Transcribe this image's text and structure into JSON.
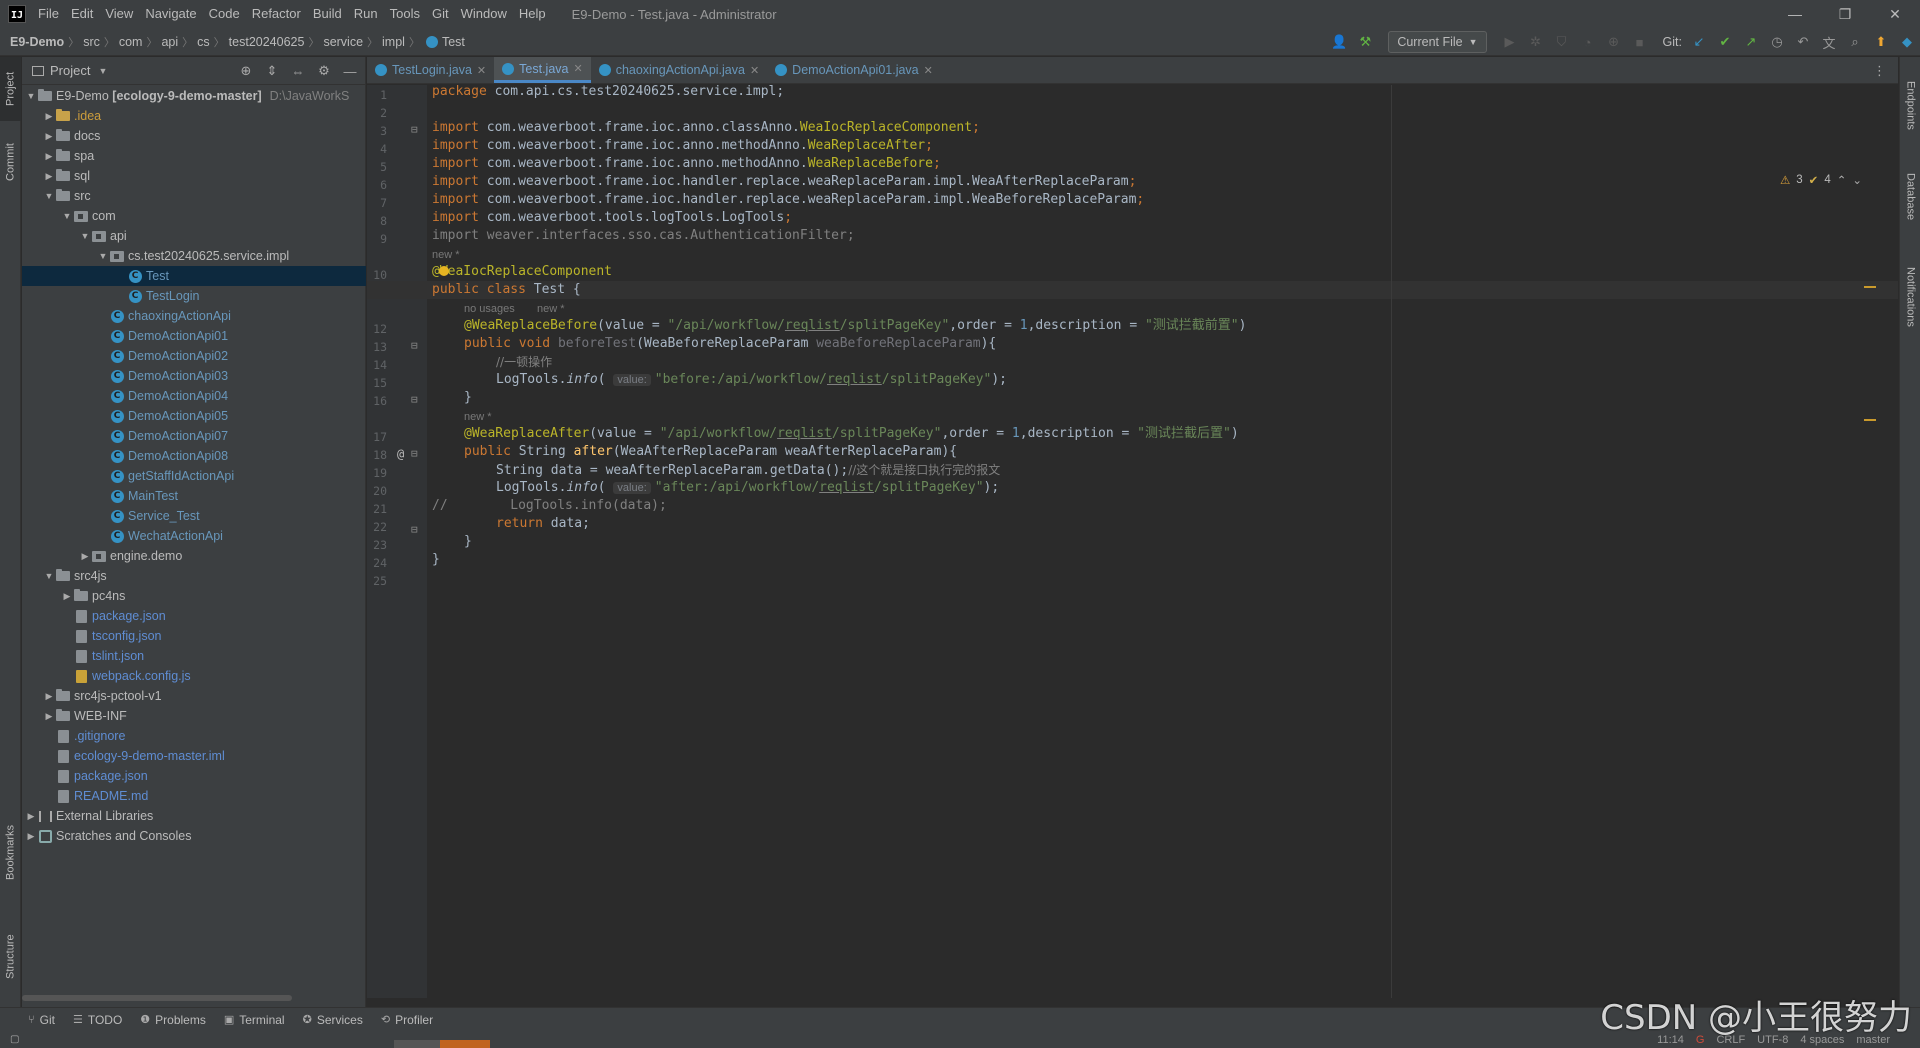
{
  "menubar": {
    "logo_text": "IJ",
    "items": [
      "File",
      "Edit",
      "View",
      "Navigate",
      "Code",
      "Refactor",
      "Build",
      "Run",
      "Tools",
      "Git",
      "Window",
      "Help"
    ],
    "window_title": "E9-Demo - Test.java - Administrator",
    "controls": {
      "minimize": "—",
      "restore": "❐",
      "close": "✕"
    }
  },
  "breadcrumb": {
    "items": [
      "E9-Demo",
      "src",
      "com",
      "api",
      "cs",
      "test20240625",
      "service",
      "impl"
    ],
    "last": "Test"
  },
  "toolbar": {
    "run_config": "Current File",
    "git_label": "Git:",
    "icons": [
      "user-icon",
      "build-hammer-icon",
      "run-icon",
      "debug-icon",
      "coverage-icon",
      "profile-icon",
      "more-run-icon",
      "stop-icon",
      "git-update-icon",
      "git-commit-icon",
      "git-push-icon",
      "history-icon",
      "rollback-icon",
      "translate-icon",
      "search-icon",
      "update-icon",
      "plugin-icon"
    ]
  },
  "left_strip": {
    "project": "Project",
    "commit": "Commit",
    "bookmarks": "Bookmarks",
    "structure": "Structure"
  },
  "right_strip": {
    "endpoints": "Endpoints",
    "database": "Database",
    "notifications": "Notifications"
  },
  "project_panel": {
    "title": "Project",
    "root_name": "E9-Demo",
    "root_module": "[ecology-9-demo-master]",
    "root_path": "D:\\JavaWorkS",
    "tree": [
      {
        "label": ".idea",
        "indent": 1,
        "arrow": "▶",
        "kind": "folder-idea",
        "color": "yellow"
      },
      {
        "label": "docs",
        "indent": 1,
        "arrow": "▶",
        "kind": "folder",
        "color": ""
      },
      {
        "label": "spa",
        "indent": 1,
        "arrow": "▶",
        "kind": "folder",
        "color": ""
      },
      {
        "label": "sql",
        "indent": 1,
        "arrow": "▶",
        "kind": "folder",
        "color": ""
      },
      {
        "label": "src",
        "indent": 1,
        "arrow": "▼",
        "kind": "folder",
        "color": ""
      },
      {
        "label": "com",
        "indent": 2,
        "arrow": "▼",
        "kind": "package",
        "color": ""
      },
      {
        "label": "api",
        "indent": 3,
        "arrow": "▼",
        "kind": "package",
        "color": ""
      },
      {
        "label": "cs.test20240625.service.impl",
        "indent": 4,
        "arrow": "▼",
        "kind": "package",
        "color": ""
      },
      {
        "label": "Test",
        "indent": 5,
        "arrow": "",
        "kind": "class",
        "color": "blue",
        "selected": true
      },
      {
        "label": "TestLogin",
        "indent": 5,
        "arrow": "",
        "kind": "class",
        "color": "blue"
      },
      {
        "label": "chaoxingActionApi",
        "indent": 4,
        "arrow": "",
        "kind": "class",
        "color": "blue"
      },
      {
        "label": "DemoActionApi01",
        "indent": 4,
        "arrow": "",
        "kind": "class",
        "color": "blue"
      },
      {
        "label": "DemoActionApi02",
        "indent": 4,
        "arrow": "",
        "kind": "class",
        "color": "blue"
      },
      {
        "label": "DemoActionApi03",
        "indent": 4,
        "arrow": "",
        "kind": "class",
        "color": "blue"
      },
      {
        "label": "DemoActionApi04",
        "indent": 4,
        "arrow": "",
        "kind": "class",
        "color": "blue"
      },
      {
        "label": "DemoActionApi05",
        "indent": 4,
        "arrow": "",
        "kind": "class",
        "color": "blue"
      },
      {
        "label": "DemoActionApi07",
        "indent": 4,
        "arrow": "",
        "kind": "class",
        "color": "blue"
      },
      {
        "label": "DemoActionApi08",
        "indent": 4,
        "arrow": "",
        "kind": "class",
        "color": "blue"
      },
      {
        "label": "getStaffIdActionApi",
        "indent": 4,
        "arrow": "",
        "kind": "class",
        "color": "blue"
      },
      {
        "label": "MainTest",
        "indent": 4,
        "arrow": "",
        "kind": "class",
        "color": "blue"
      },
      {
        "label": "Service_Test",
        "indent": 4,
        "arrow": "",
        "kind": "class",
        "color": "blue"
      },
      {
        "label": "WechatActionApi",
        "indent": 4,
        "arrow": "",
        "kind": "class",
        "color": "blue"
      },
      {
        "label": "engine.demo",
        "indent": 3,
        "arrow": "▶",
        "kind": "package",
        "color": ""
      },
      {
        "label": "src4js",
        "indent": 1,
        "arrow": "▼",
        "kind": "folder",
        "color": ""
      },
      {
        "label": "pc4ns",
        "indent": 2,
        "arrow": "▶",
        "kind": "folder",
        "color": ""
      },
      {
        "label": "package.json",
        "indent": 2,
        "arrow": "",
        "kind": "file",
        "color": "blue-file"
      },
      {
        "label": "tsconfig.json",
        "indent": 2,
        "arrow": "",
        "kind": "file",
        "color": "blue-file"
      },
      {
        "label": "tslint.json",
        "indent": 2,
        "arrow": "",
        "kind": "file",
        "color": "blue-file"
      },
      {
        "label": "webpack.config.js",
        "indent": 2,
        "arrow": "",
        "kind": "file-js",
        "color": "blue-file"
      },
      {
        "label": "src4js-pctool-v1",
        "indent": 1,
        "arrow": "▶",
        "kind": "folder",
        "color": ""
      },
      {
        "label": "WEB-INF",
        "indent": 1,
        "arrow": "▶",
        "kind": "folder",
        "color": ""
      },
      {
        "label": ".gitignore",
        "indent": 1,
        "arrow": "",
        "kind": "file",
        "color": "blue-file"
      },
      {
        "label": "ecology-9-demo-master.iml",
        "indent": 1,
        "arrow": "",
        "kind": "file",
        "color": "blue-file"
      },
      {
        "label": "package.json",
        "indent": 1,
        "arrow": "",
        "kind": "file",
        "color": "blue-file"
      },
      {
        "label": "README.md",
        "indent": 1,
        "arrow": "",
        "kind": "file",
        "color": "blue-file"
      },
      {
        "label": "External Libraries",
        "indent": 0,
        "arrow": "▶",
        "kind": "lib",
        "color": ""
      },
      {
        "label": "Scratches and Consoles",
        "indent": 0,
        "arrow": "▶",
        "kind": "scratch",
        "color": ""
      }
    ]
  },
  "editor_tabs": [
    {
      "label": "TestLogin.java",
      "active": false
    },
    {
      "label": "Test.java",
      "active": true
    },
    {
      "label": "chaoxingActionApi.java",
      "active": false
    },
    {
      "label": "DemoActionApi01.java",
      "active": false
    }
  ],
  "inspection": {
    "warnings": "3",
    "weak_warnings": "4"
  },
  "code": {
    "line_numbers": [
      "1",
      "2",
      "3",
      "4",
      "5",
      "6",
      "7",
      "8",
      "9",
      "10",
      "11",
      "12",
      "13",
      "14",
      "15",
      "16",
      "17",
      "18",
      "19",
      "20",
      "21",
      "22",
      "23",
      "24",
      "25"
    ],
    "hint_new_class": "new *",
    "hint_usages": "no usages",
    "hint_new_method": "new *",
    "hint_new_method2": "new *",
    "param_hint": "value:",
    "l1_pkg": "package",
    "l1_rest": " com.api.cs.test20240625.service.impl;",
    "import_kw": "import",
    "l3_path": " com.weaverboot.frame.ioc.anno.classAnno.",
    "l3_cls": "WeaIocReplaceComponent",
    "l4_path": " com.weaverboot.frame.ioc.anno.methodAnno.",
    "l4_cls": "WeaReplaceAfter",
    "l5_path": " com.weaverboot.frame.ioc.anno.methodAnno.",
    "l5_cls": "WeaReplaceBefore",
    "l6_rest": " com.weaverboot.frame.ioc.handler.replace.weaReplaceParam.impl.WeaAfterReplaceParam",
    "l7_rest": " com.weaverboot.frame.ioc.handler.replace.weaReplaceParam.impl.WeaBeforeReplaceParam",
    "l8_rest": " com.weaverboot.tools.logTools.LogTools",
    "l9_rest": " weaver.interfaces.sso.cas.AuthenticationFilter;",
    "semi": ";",
    "l10_ann": "@WeaIocReplaceComponent",
    "l11_public": "public",
    "l11_class": "class",
    "l11_name": "Test",
    "l11_brace": " {",
    "l12_ann": "@WeaReplaceBefore",
    "l12_open": "(value = ",
    "l12_str_a": "\"/api/workflow/",
    "l12_str_u": "reqlist",
    "l12_str_b": "/splitPageKey\"",
    "l12_order": ",order = ",
    "num1": "1",
    "l12_desc": ",description = ",
    "l12_desc_str": "\"测试拦截前置\"",
    "close_paren": ")",
    "l13_void": "void",
    "l13_name": "beforeTest",
    "l13_type": "(WeaBeforeReplaceParam ",
    "l13_param": "weaBeforeReplaceParam",
    "l13_end": "){",
    "l14_cmt": "//一顿操作",
    "l15_call": "LogTools.",
    "info": "info",
    "l15_str_a": "\"before:/api/workflow/",
    "l15_str_b": "/splitPageKey\"",
    "l15_end": ");",
    "rbrace": "}",
    "l17_ann": "@WeaReplaceAfter",
    "l17_desc_str": "\"测试拦截后置\"",
    "l18_string": " String ",
    "l18_name": "after",
    "l18_param": "(WeaAfterReplaceParam weaAfterReplaceParam){",
    "l19_code": "String data = weaAfterReplaceParam.getData();",
    "l19_cmt": "//这个就是接口执行完的报文",
    "l20_str_a": "\"after:/api/workflow/",
    "l21_cmt": "//        LogTools.info(data);",
    "l22_return": "return",
    "l22_rest": " data;"
  },
  "bottom_tools": [
    {
      "icon": "git-branch-icon",
      "glyph": "⑂",
      "label": "Git"
    },
    {
      "icon": "todo-icon",
      "glyph": "☰",
      "label": "TODO"
    },
    {
      "icon": "problems-icon",
      "glyph": "❶",
      "label": "Problems"
    },
    {
      "icon": "terminal-icon",
      "glyph": "▣",
      "label": "Terminal"
    },
    {
      "icon": "services-icon",
      "glyph": "✪",
      "label": "Services"
    },
    {
      "icon": "profiler-icon",
      "glyph": "⟲",
      "label": "Profiler"
    }
  ],
  "status_bar": {
    "position": "11:14",
    "line_sep": "CRLF",
    "encoding": "UTF-8",
    "indent": "4 spaces",
    "branch": "master"
  },
  "watermark": "CSDN @小王很努力"
}
